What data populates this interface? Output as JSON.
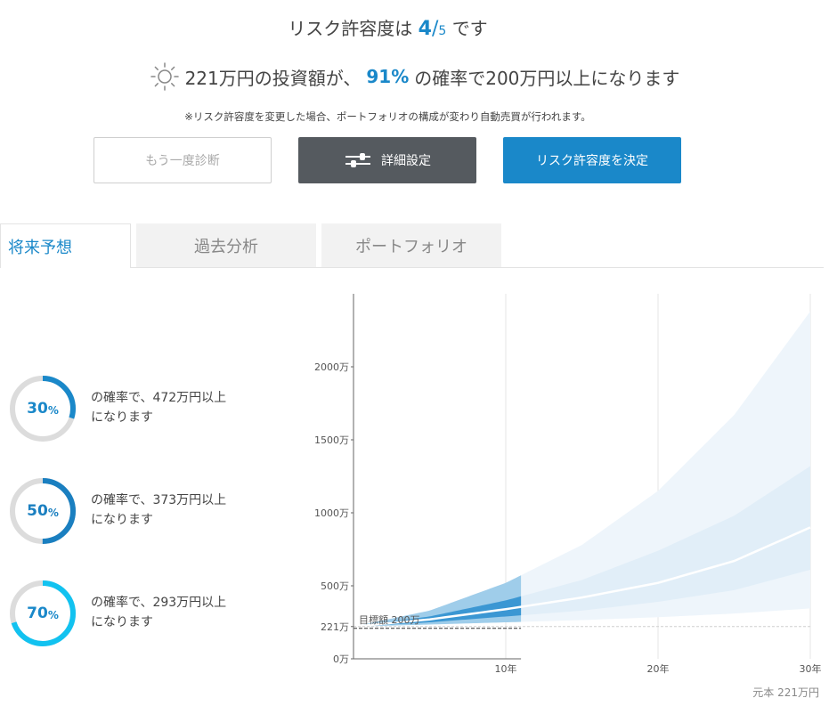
{
  "header": {
    "risk_prefix": "リスク許容度は",
    "risk_value": "4",
    "risk_slash": "/",
    "risk_max": "5",
    "risk_suffix": "です",
    "amount_text": "221万円の投資額が、",
    "probability": "91%",
    "target_text": "の確率で200万円以上になります",
    "sun_icon": "sun-icon",
    "note": "※リスク許容度を変更した場合、ポートフォリオの構成が変わり自動売買が行われます。"
  },
  "buttons": {
    "retry": "もう一度診断",
    "detail": "詳細設定",
    "detail_icon": "sliders-icon",
    "decide": "リスク許容度を決定"
  },
  "tabs": [
    {
      "label": "将来予想",
      "active": true
    },
    {
      "label": "過去分析",
      "active": false
    },
    {
      "label": "ポートフォリオ",
      "active": false
    }
  ],
  "probabilities": [
    {
      "pct": "30",
      "unit": "%",
      "fraction": 0.3,
      "color": "#1a88c9",
      "line1": "の確率で、472万円以上",
      "line2": "になります"
    },
    {
      "pct": "50",
      "unit": "%",
      "fraction": 0.5,
      "color": "#1a7fc0",
      "line1": "の確率で、373万円以上",
      "line2": "になります"
    },
    {
      "pct": "70",
      "unit": "%",
      "fraction": 0.7,
      "color": "#12c2f0",
      "line1": "の確率で、293万円以上",
      "line2": "になります"
    }
  ],
  "chart_data": {
    "type": "area",
    "x_ticks": [
      {
        "value": 10,
        "label": "10年"
      },
      {
        "value": 20,
        "label": "20年"
      },
      {
        "value": 30,
        "label": "30年"
      }
    ],
    "y_ticks": [
      {
        "value": 0,
        "label": "0万"
      },
      {
        "value": 221,
        "label": "221万"
      },
      {
        "value": 500,
        "label": "500万"
      },
      {
        "value": 1000,
        "label": "1000万"
      },
      {
        "value": 1500,
        "label": "1500万"
      },
      {
        "value": 2000,
        "label": "2000万"
      }
    ],
    "xlim": [
      0,
      30
    ],
    "ylim": [
      0,
      2500
    ],
    "highlight_until_year": 11,
    "target_label": "目標額 200万",
    "target_value": 200,
    "principal_value": 221,
    "series": [
      {
        "role": "outer_upper",
        "x": [
          0,
          5,
          10,
          15,
          20,
          25,
          30
        ],
        "values": [
          221,
          330,
          520,
          780,
          1150,
          1670,
          2380
        ]
      },
      {
        "role": "inner_upper",
        "x": [
          0,
          5,
          10,
          15,
          20,
          25,
          30
        ],
        "values": [
          221,
          290,
          400,
          540,
          740,
          980,
          1320
        ]
      },
      {
        "role": "median",
        "x": [
          0,
          5,
          10,
          15,
          20,
          25,
          30
        ],
        "values": [
          221,
          270,
          340,
          420,
          520,
          670,
          900
        ]
      },
      {
        "role": "inner_lower",
        "x": [
          0,
          5,
          10,
          15,
          20,
          25,
          30
        ],
        "values": [
          221,
          250,
          290,
          330,
          390,
          470,
          610
        ]
      },
      {
        "role": "outer_lower",
        "x": [
          0,
          5,
          10,
          15,
          20,
          25,
          30
        ],
        "values": [
          221,
          235,
          250,
          265,
          285,
          310,
          345
        ]
      }
    ]
  },
  "footer": {
    "principal": "元本 221万円"
  }
}
